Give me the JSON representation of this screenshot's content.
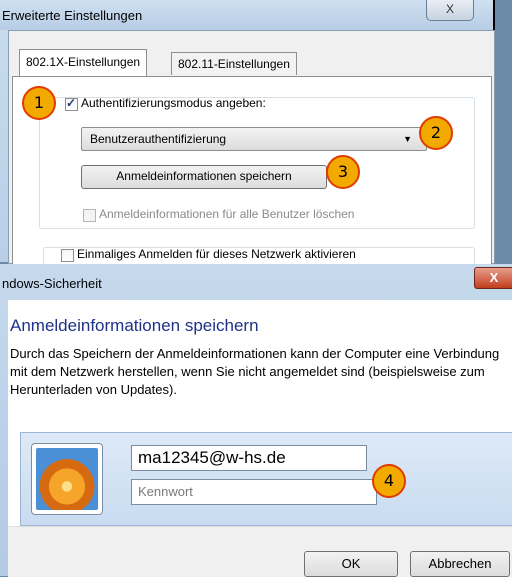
{
  "settings_window": {
    "title": "Erweiterte Einstellungen",
    "close_label": "X",
    "tabs": [
      {
        "label": "802.1X-Einstellungen",
        "active": true
      },
      {
        "label": "802.11-Einstellungen",
        "active": false
      }
    ],
    "auth_mode_checkbox": {
      "label": "Authentifizierungsmodus angeben:",
      "checked": true
    },
    "auth_mode_select": {
      "value": "Benutzerauthentifizierung"
    },
    "save_credentials_button": "Anmeldeinformationen speichern",
    "delete_all_checkbox": {
      "label": "Anmeldeinformationen für alle Benutzer löschen",
      "checked": false,
      "disabled": true
    },
    "sso_checkbox": {
      "label": "Einmaliges Anmelden für dieses Netzwerk aktivieren",
      "checked": false
    }
  },
  "security_window": {
    "title": "ndows-Sicherheit",
    "close_label": "X",
    "heading": "Anmeldeinformationen speichern",
    "description": "Durch das Speichern der Anmeldeinformationen kann der Computer eine Verbindung mit dem Netzwerk herstellen, wenn Sie nicht angemeldet sind (beispielsweise zum Herunterladen von Updates).",
    "username_value": "ma12345@w-hs.de",
    "password_placeholder": "Kennwort",
    "ok_button": "OK",
    "cancel_button": "Abbrechen"
  },
  "annotations": [
    "1",
    "2",
    "3",
    "4"
  ],
  "colors": {
    "badge_fill": "#f2a900",
    "badge_border": "#e03c00",
    "heading": "#1e3287"
  }
}
